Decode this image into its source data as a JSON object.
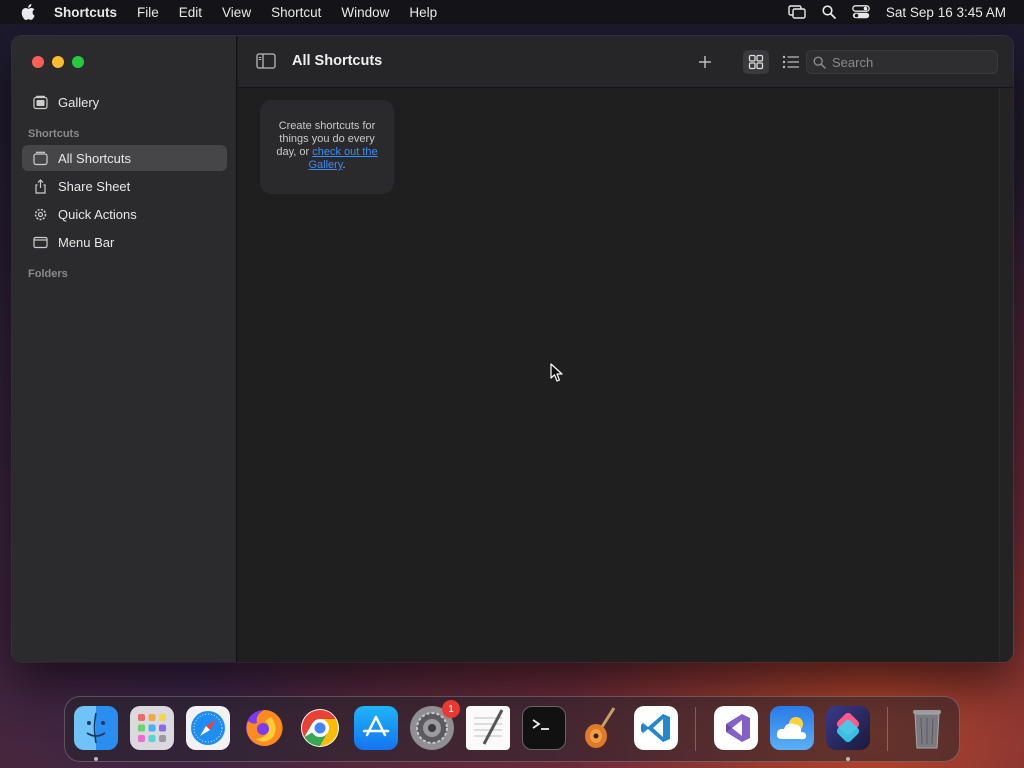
{
  "menubar": {
    "app_name": "Shortcuts",
    "items": [
      "File",
      "Edit",
      "View",
      "Shortcut",
      "Window",
      "Help"
    ],
    "clock": "Sat Sep 16  3:45 AM"
  },
  "sidebar": {
    "gallery": "Gallery",
    "section_shortcuts": "Shortcuts",
    "items": [
      {
        "label": "All Shortcuts",
        "icon": "stack-icon",
        "selected": true
      },
      {
        "label": "Share Sheet",
        "icon": "share-icon"
      },
      {
        "label": "Quick Actions",
        "icon": "gear-icon"
      },
      {
        "label": "Menu Bar",
        "icon": "menubar-icon"
      }
    ],
    "section_folders": "Folders"
  },
  "toolbar": {
    "title": "All Shortcuts",
    "search_placeholder": "Search"
  },
  "empty_state": {
    "text": "Create shortcuts for things you do every day, or ",
    "link": "check out the Gallery",
    "suffix": "."
  },
  "dock": {
    "apps": [
      "Finder",
      "Launchpad",
      "Safari",
      "Firefox",
      "Chrome",
      "App Store",
      "System Settings",
      "TextEdit",
      "Terminal",
      "GarageBand",
      "Visual Studio Code",
      "Visual Studio",
      "Weather",
      "Shortcuts",
      "Trash"
    ],
    "settings_badge": "1"
  },
  "colors": {
    "accent": "#3b8cf5",
    "close": "#ff5f57",
    "minimize": "#febc2e",
    "maximize": "#28c840"
  }
}
